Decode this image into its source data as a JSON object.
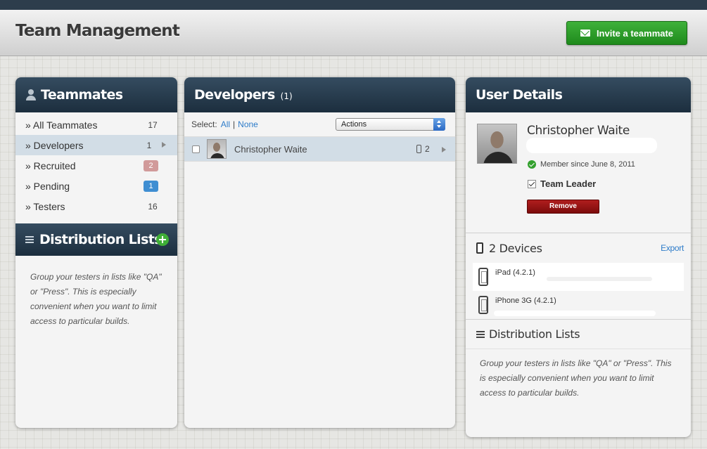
{
  "header": {
    "title": "Team Management",
    "invite_label": "Invite a teammate"
  },
  "teammates": {
    "title": "Teammates",
    "items": [
      {
        "label": "» All Teammates",
        "count": "17"
      },
      {
        "label": "» Developers",
        "count": "1"
      },
      {
        "label": "» Recruited",
        "count": "2"
      },
      {
        "label": "» Pending",
        "count": "1"
      },
      {
        "label": "» Testers",
        "count": "16"
      }
    ]
  },
  "distribution": {
    "title": "Distribution Lists",
    "hint": "Group your testers in lists like \"QA\" or \"Press\". This is especially convenient when you want to limit access to particular builds."
  },
  "developers": {
    "title": "Developers",
    "count": "(1)",
    "select_label": "Select:",
    "select_all": "All",
    "separator": "|",
    "select_none": "None",
    "actions_label": "Actions",
    "rows": [
      {
        "name": "Christopher Waite",
        "devices": "2"
      }
    ]
  },
  "user_details": {
    "title": "User Details",
    "name": "Christopher Waite",
    "member_since": "Member since June 8, 2011",
    "role": "Team Leader",
    "remove_label": "Remove",
    "devices_title": "2 Devices",
    "export_label": "Export",
    "devices": [
      {
        "name": "iPad (4.2.1)"
      },
      {
        "name": "iPhone 3G (4.2.1)"
      }
    ],
    "dist_title": "Distribution Lists",
    "dist_hint": "Group your testers in lists like \"QA\" or \"Press\". This is especially convenient when you want to limit access to particular builds."
  },
  "colors": {
    "header_dark": "#1c2e3e",
    "accent_green": "#2a9a27",
    "link_blue": "#2e7cc9",
    "remove_red": "#9a1414",
    "selection": "#d2dde6"
  }
}
